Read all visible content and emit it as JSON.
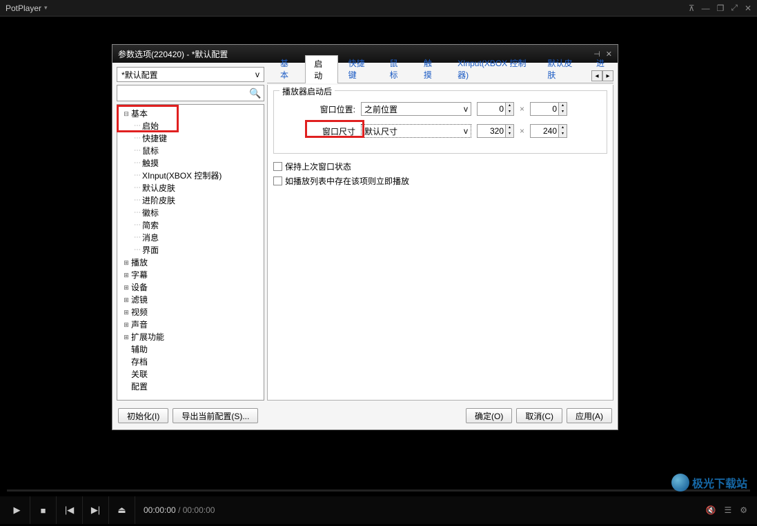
{
  "app": {
    "title": "PotPlayer"
  },
  "window_buttons": {
    "pin": "⊼",
    "min": "—",
    "restore": "❐",
    "full": "⤢",
    "close": "✕"
  },
  "dialog": {
    "title": "参数选项(220420) - *默认配置",
    "profile_combo": "*默认配置",
    "tabs": [
      "基本",
      "启动",
      "快捷键",
      "鼠标",
      "触摸",
      "XInput(XBOX 控制器)",
      "默认皮肤",
      "进"
    ],
    "active_tab": 1,
    "group_title": "播放器启动后",
    "row1": {
      "label": "窗口位置:",
      "select": "之前位置",
      "v1": "0",
      "v2": "0"
    },
    "row2": {
      "label": "窗口尺寸",
      "select": "默认尺寸",
      "v1": "320",
      "v2": "240"
    },
    "chk1": "保持上次窗口状态",
    "chk2": "如播放列表中存在该项则立即播放",
    "buttons": {
      "init": "初始化(I)",
      "export": "导出当前配置(S)...",
      "ok": "确定(O)",
      "cancel": "取消(C)",
      "apply": "应用(A)"
    }
  },
  "tree": {
    "root": {
      "label": "基本",
      "children": [
        "启始",
        "快捷键",
        "鼠标",
        "触摸",
        "XInput(XBOX 控制器)",
        "默认皮肤",
        "进阶皮肤",
        "徽标",
        "简索",
        "消息",
        "界面"
      ]
    },
    "siblings": [
      {
        "label": "播放",
        "exp": true
      },
      {
        "label": "字幕",
        "exp": true
      },
      {
        "label": "设备",
        "exp": true
      },
      {
        "label": "滤镜",
        "exp": true
      },
      {
        "label": "视频",
        "exp": true
      },
      {
        "label": "声音",
        "exp": true
      },
      {
        "label": "扩展功能",
        "exp": true
      },
      {
        "label": "辅助",
        "exp": false
      },
      {
        "label": "存档",
        "exp": false
      },
      {
        "label": "关联",
        "exp": false
      },
      {
        "label": "配置",
        "exp": false
      }
    ]
  },
  "player": {
    "time_cur": "00:00:00",
    "time_total": "00:00:00"
  },
  "watermark": "极光下载站"
}
